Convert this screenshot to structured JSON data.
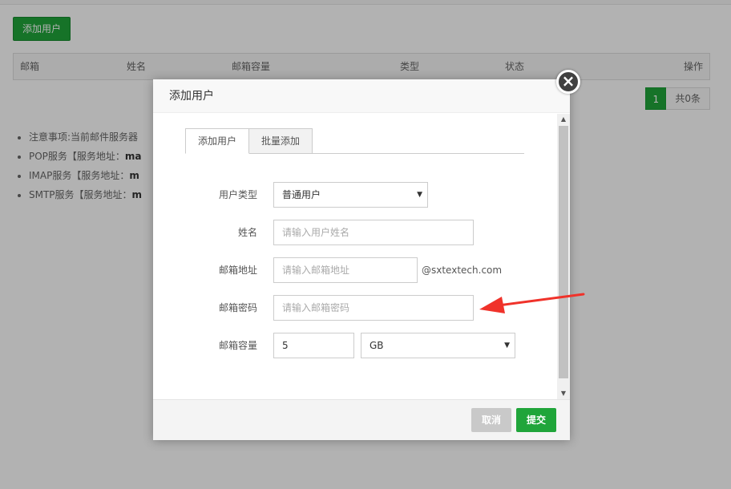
{
  "page": {
    "add_user_button": "添加用户",
    "columns": [
      "邮箱",
      "姓名",
      "邮箱容量",
      "类型",
      "状态",
      "操作"
    ],
    "pager": {
      "current": "1",
      "total": "共0条"
    },
    "notes": [
      {
        "text": "注意事项:当前邮件服务器",
        "bold": ""
      },
      {
        "text": "POP服务【服务地址：",
        "bold": "ma"
      },
      {
        "text": "IMAP服务【服务地址：",
        "bold": "m"
      },
      {
        "text": "SMTP服务【服务地址：",
        "bold": "m"
      }
    ]
  },
  "dialog": {
    "title": "添加用户",
    "close_glyph": "×",
    "tabs": [
      "添加用户",
      "批量添加"
    ],
    "fields": {
      "user_type": {
        "label": "用户类型",
        "value": "普通用户"
      },
      "name": {
        "label": "姓名",
        "placeholder": "请输入用户姓名"
      },
      "email": {
        "label": "邮箱地址",
        "placeholder": "请输入邮箱地址",
        "suffix": "@sxtextech.com"
      },
      "password": {
        "label": "邮箱密码",
        "placeholder": "请输入邮箱密码"
      },
      "quota": {
        "label": "邮箱容量",
        "value": "5",
        "unit": "GB"
      }
    },
    "cancel_label": "取消",
    "submit_label": "提交"
  },
  "colors": {
    "accent": "#20a53a",
    "annotation_arrow": "#f0322a",
    "overlay": "rgba(0,0,0,0.30)"
  }
}
